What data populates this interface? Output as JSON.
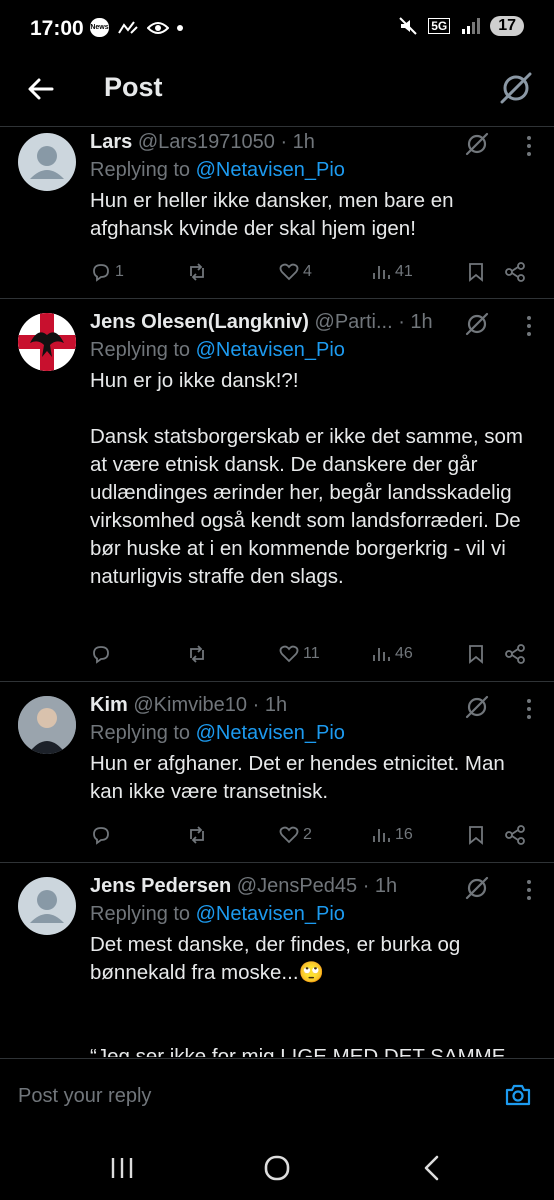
{
  "status_bar": {
    "time": "17:00",
    "news_badge": "News",
    "network": "5G",
    "battery": "17"
  },
  "header": {
    "title": "Post"
  },
  "tweets": [
    {
      "name": "Lars",
      "handle": "@Lars1971050",
      "time": "· 1h",
      "replying_prefix": "Replying to ",
      "replying_handle": "@Netavisen_Pio",
      "text": "Hun er heller ikke dansker, men bare en afghansk kvinde der skal hjem igen!",
      "replies": "1",
      "reposts": "",
      "likes": "4",
      "views": "41",
      "avatar": "default-avatar"
    },
    {
      "name": "Jens Olesen(Langkniv)",
      "handle": "@Parti...",
      "time": "· 1h",
      "replying_prefix": "Replying to ",
      "replying_handle": "@Netavisen_Pio",
      "text": "Hun er jo ikke dansk!?!\n\nDansk statsborgerskab er ikke det samme, som at være etnisk dansk. De danskere der går udlændinges ærinder her, begår landsskadelig virksomhed også kendt som landsforræderi. De bør huske at i en kommende borgerkrig - vil vi naturligvis straffe den slags.",
      "replies": "",
      "reposts": "",
      "likes": "11",
      "views": "46",
      "avatar": "raven-flag-avatar"
    },
    {
      "name": "Kim",
      "handle": "@Kimvibe10",
      "time": "· 1h",
      "replying_prefix": "Replying to ",
      "replying_handle": "@Netavisen_Pio",
      "text": "Hun er afghaner. Det er hendes etnicitet. Man kan ikke være transetnisk.",
      "replies": "",
      "reposts": "",
      "likes": "2",
      "views": "16",
      "avatar": "photo-avatar"
    },
    {
      "name": "Jens Pedersen",
      "handle": "@JensPed45",
      "time": "· 1h",
      "replying_prefix": "Replying to ",
      "replying_handle": "@Netavisen_Pio",
      "text": "Det mest danske, der findes, er burka og bønnekald fra moske...🙄\n\n\n“Jeg ser ikke for mig LIGE MED DET SAMME,",
      "avatar": "default-avatar"
    }
  ],
  "composer": {
    "placeholder": "Post your reply"
  },
  "colors": {
    "accent": "#1d9bf0",
    "muted": "#71767b",
    "text": "#e7e9ea",
    "divider": "#2f3336"
  }
}
